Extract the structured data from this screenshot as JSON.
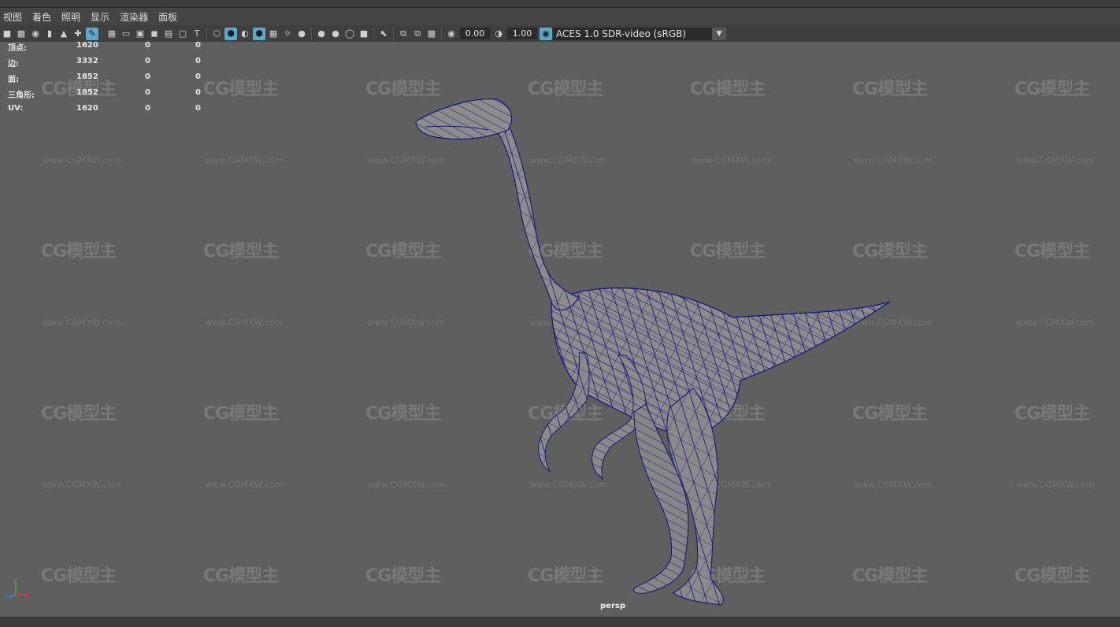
{
  "menu": [
    "视图",
    "着色",
    "照明",
    "显示",
    "渲染器",
    "面板"
  ],
  "toolbar": {
    "exposure_value": "0.00",
    "gamma_value": "1.00",
    "color_space": "ACES 1.0 SDR-video (sRGB)"
  },
  "hud": {
    "rows": [
      {
        "label": "顶点:",
        "v1": "1620",
        "v2": "0",
        "v3": "0"
      },
      {
        "label": "边:",
        "v1": "3332",
        "v2": "0",
        "v3": "0"
      },
      {
        "label": "面:",
        "v1": "1852",
        "v2": "0",
        "v3": "0"
      },
      {
        "label": "三角形:",
        "v1": "1852",
        "v2": "0",
        "v3": "0"
      },
      {
        "label": "UV:",
        "v1": "1620",
        "v2": "0",
        "v3": "0"
      }
    ]
  },
  "watermark": {
    "logo": "CG模型主",
    "url": "www.CGMXW.com"
  },
  "axes": {
    "y": "y",
    "z": "z",
    "x": "x"
  },
  "viewport": {
    "camera": "persp"
  },
  "colors": {
    "wire": "#1a1a7a",
    "mesh": "#8a8a8a",
    "accent": "#5fa8c8"
  }
}
